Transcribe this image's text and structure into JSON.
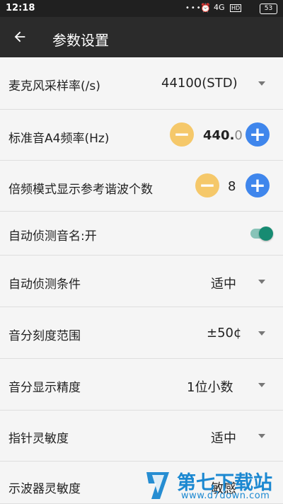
{
  "status": {
    "time": "12:18",
    "dots": "•••",
    "alarm": "⏰",
    "signal": "4G",
    "hd": "HD",
    "battery": "53"
  },
  "header": {
    "title": "参数设置",
    "back_icon": "back-arrow-icon"
  },
  "rows": [
    {
      "label": "麦克风采样率(/s)",
      "value": "44100(STD)"
    },
    {
      "label": "标准音A4频率(Hz)",
      "value_main": "440.",
      "value_tail": "0",
      "minus": "−",
      "plus": "+"
    },
    {
      "label": "倍频模式显示参考谐波个数",
      "value": "8",
      "minus": "−",
      "plus": "+"
    },
    {
      "label": "自动侦测音名:开",
      "toggle": true
    },
    {
      "label": "自动侦测条件",
      "value": "适中"
    },
    {
      "label": "音分刻度范围",
      "value": "±50¢"
    },
    {
      "label": "音分显示精度",
      "value": "1位小数"
    },
    {
      "label": "指针灵敏度",
      "value": "适中"
    },
    {
      "label": "示波器灵敏度",
      "value": "敏感"
    }
  ],
  "watermark": {
    "brand": "第七下载站",
    "url": "www.d7down.com"
  },
  "colors": {
    "minus": "#f5c86a",
    "plus": "#3f86ec",
    "toggle": "#178b72",
    "header": "#2b2b2b"
  }
}
